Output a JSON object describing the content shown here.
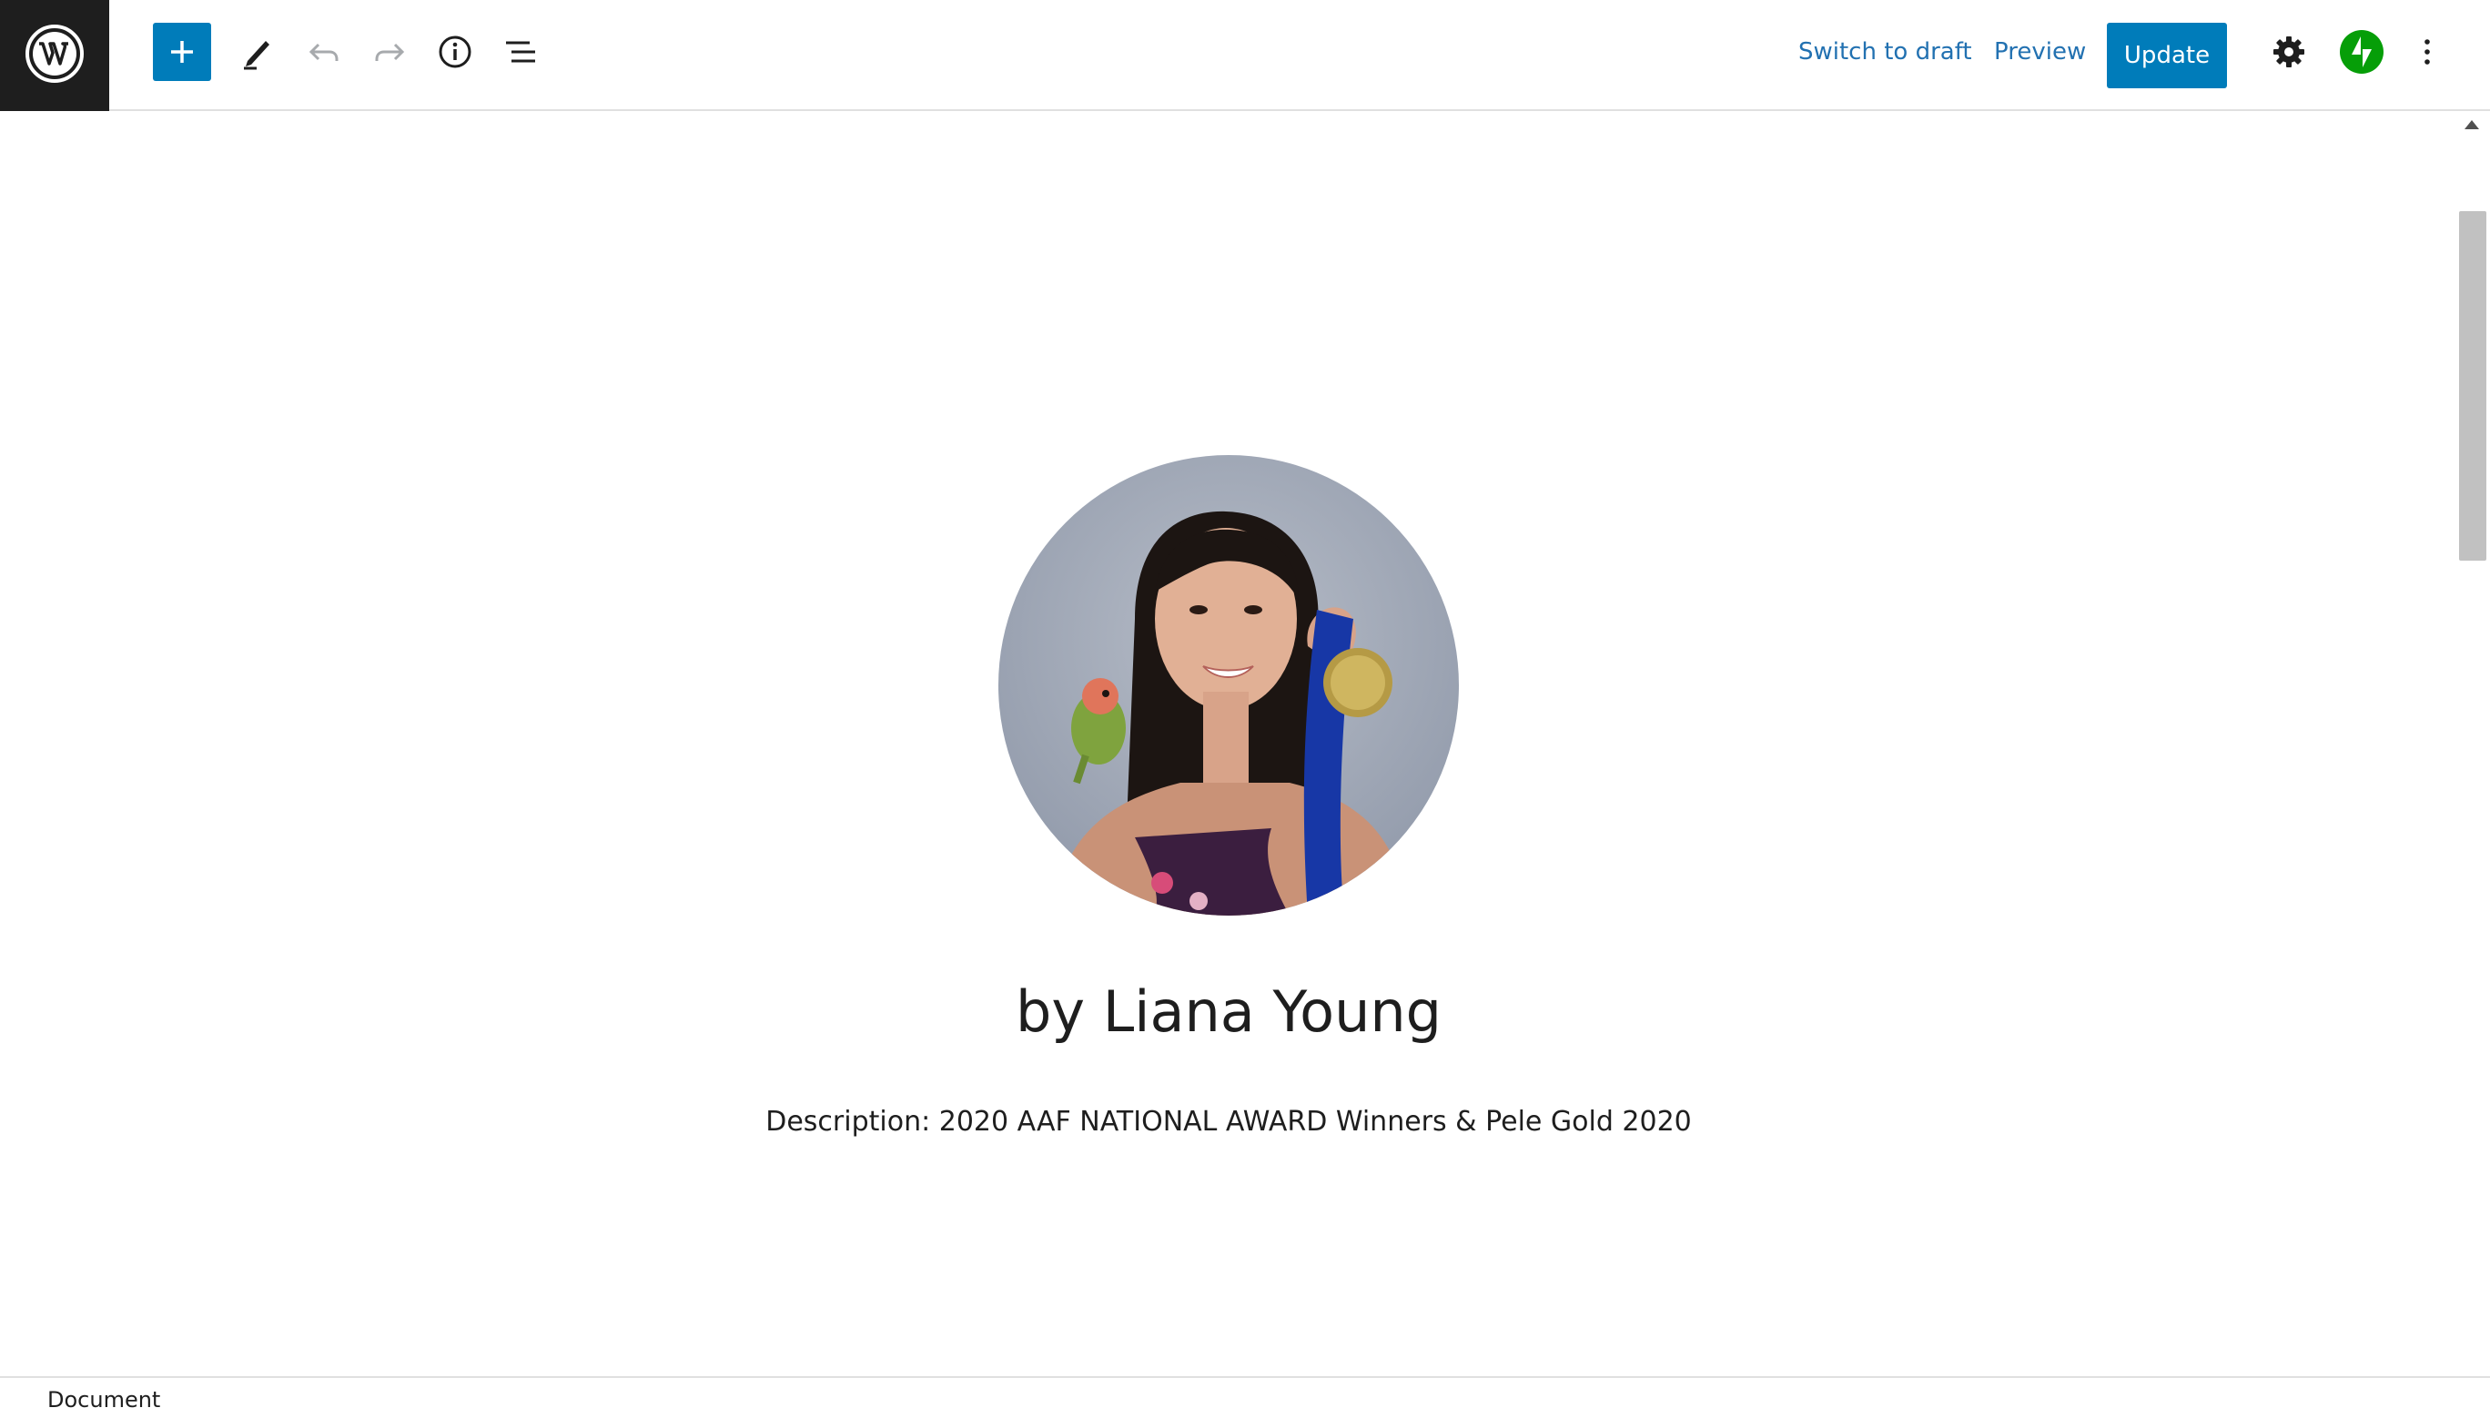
{
  "toolbar": {
    "switch_to_draft_label": "Switch to draft",
    "preview_label": "Preview",
    "update_label": "Update"
  },
  "icons": {
    "logo": "wordpress-logo-icon",
    "add": "plus-icon",
    "edit": "pencil-icon",
    "undo": "undo-icon",
    "redo": "redo-icon",
    "info": "info-icon",
    "list_view": "list-view-icon",
    "settings": "gear-icon",
    "jetpack": "jetpack-bolt-icon",
    "options": "more-vertical-icon"
  },
  "content": {
    "avatar_image": "profile-photo-woman-with-bird-and-medal",
    "byline": "by Liana Young",
    "description": "Description: 2020 AAF NATIONAL AWARD Winners & Pele Gold 2020"
  },
  "footer": {
    "breadcrumb": "Document"
  },
  "colors": {
    "accent": "#007cba",
    "link": "#2271b1",
    "jetpack": "#069e08",
    "logo_bg": "#1e1e1e"
  }
}
